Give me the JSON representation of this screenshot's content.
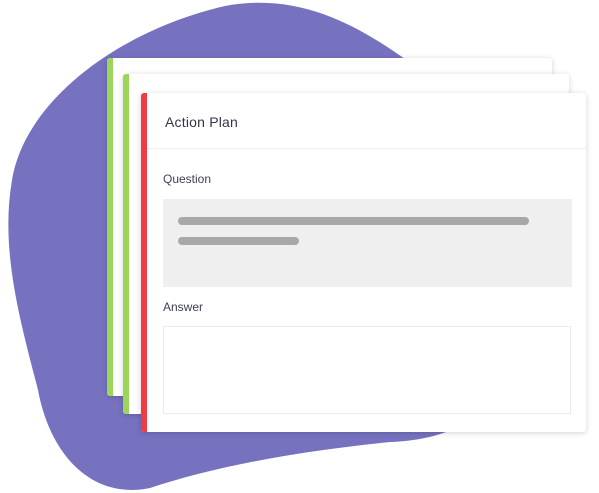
{
  "card": {
    "title": "Action Plan",
    "question_label": "Question",
    "answer_label": "Answer",
    "answer_value": ""
  },
  "colors": {
    "blob": "#7672c0",
    "accent_back": "#9bd65a",
    "accent_front": "#f03a46",
    "text": "#33364a"
  },
  "icons": {
    "question_placeholder": "skeleton-text-lines"
  }
}
